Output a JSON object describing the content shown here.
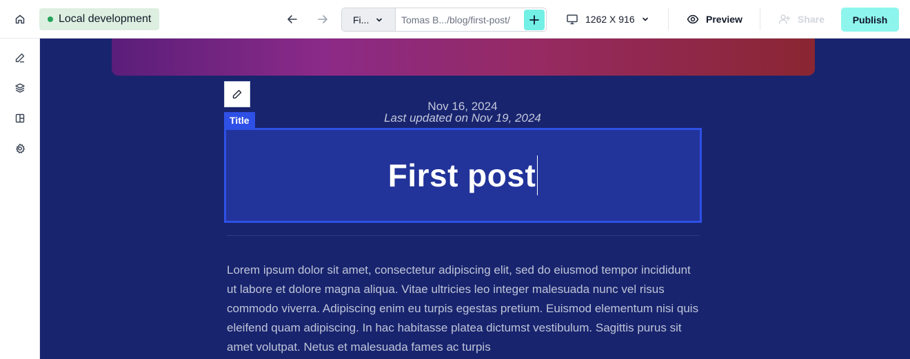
{
  "topbar": {
    "env_label": "Local development",
    "page_select": "Fi...",
    "url": "Tomas B.../blog/first-post/",
    "viewport": "1262 X 916",
    "preview_label": "Preview",
    "share_label": "Share",
    "publish_label": "Publish"
  },
  "colors": {
    "canvas_bg": "#18246e",
    "selection": "#2f50e6",
    "publish_bg": "#8ef5ed",
    "env_badge_bg": "#dcefe0",
    "env_dot": "#22a35a"
  },
  "icons": {
    "home": "home-icon",
    "back": "arrow-left-icon",
    "forward": "arrow-right-icon",
    "add": "plus-icon",
    "monitor": "monitor-icon",
    "eye": "eye-icon",
    "share": "user-plus-icon",
    "rail": [
      "pencil-icon",
      "layers-icon",
      "layout-icon",
      "gear-icon"
    ]
  },
  "post": {
    "date": "Nov 16, 2024",
    "updated": "Last updated on Nov 19, 2024",
    "title_tag": "Title",
    "title": "First post",
    "body": "Lorem ipsum dolor sit amet, consectetur adipiscing elit, sed do eiusmod tempor incididunt ut labore et dolore magna aliqua. Vitae ultricies leo integer malesuada nunc vel risus commodo viverra. Adipiscing enim eu turpis egestas pretium. Euismod elementum nisi quis eleifend quam adipiscing. In hac habitasse platea dictumst vestibulum. Sagittis purus sit amet volutpat. Netus et malesuada fames ac turpis"
  }
}
